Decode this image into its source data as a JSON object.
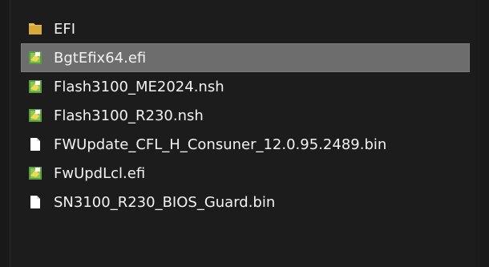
{
  "colors": {
    "background": "#1c1c1c",
    "selected_row": "#6d6d6d",
    "text": "#f2f2f2",
    "folder": "#e7bf4f",
    "efi_icon_green": "#6bb44b",
    "efi_icon_yellow": "#f2da4f",
    "generic_file": "#ffffff"
  },
  "files": [
    {
      "name": "EFI",
      "icon": "folder-icon",
      "selected": false
    },
    {
      "name": "BgtEfix64.efi",
      "icon": "efi-file-icon",
      "selected": true
    },
    {
      "name": "Flash3100_ME2024.nsh",
      "icon": "efi-file-icon",
      "selected": false
    },
    {
      "name": "Flash3100_R230.nsh",
      "icon": "efi-file-icon",
      "selected": false
    },
    {
      "name": "FWUpdate_CFL_H_Consuner_12.0.95.2489.bin",
      "icon": "generic-file-icon",
      "selected": false
    },
    {
      "name": "FwUpdLcl.efi",
      "icon": "efi-file-icon",
      "selected": false
    },
    {
      "name": "SN3100_R230_BIOS_Guard.bin",
      "icon": "generic-file-icon",
      "selected": false
    }
  ]
}
